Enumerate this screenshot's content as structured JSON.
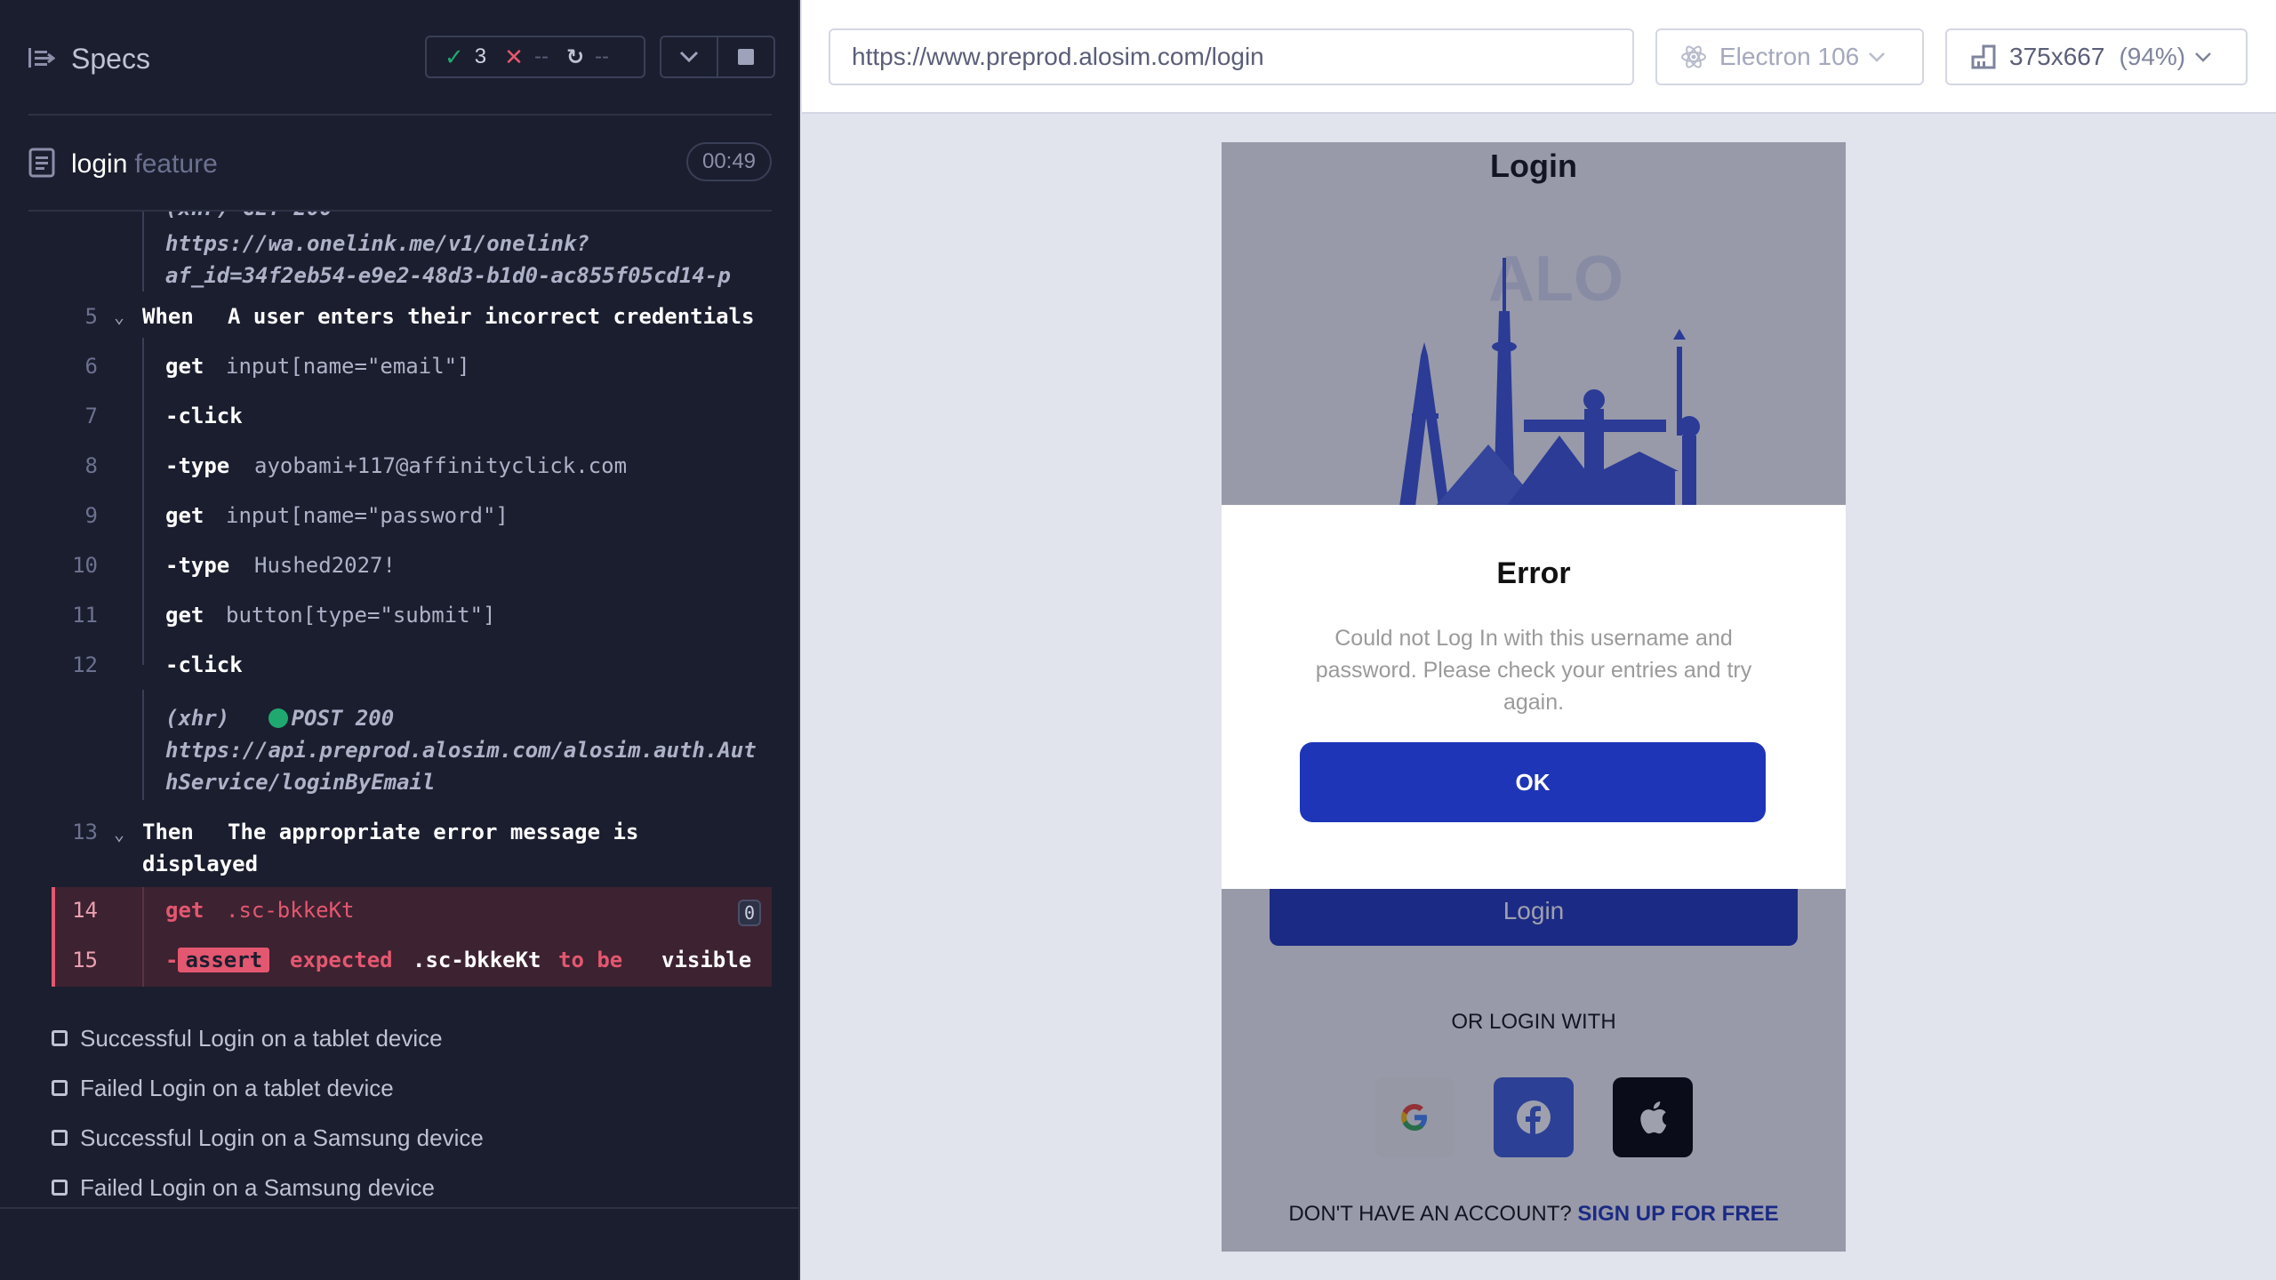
{
  "reporter": {
    "title": "Specs",
    "stats": {
      "passed": "3",
      "failed": "--",
      "pending": "--"
    },
    "feature": {
      "name": "login",
      "kind": "feature",
      "duration": "00:49"
    },
    "commands": {
      "xhr_prev": {
        "partial": "(xhr)   GET 200",
        "url_line1": "https://wa.onelink.me/v1/onelink?",
        "url_line2": "af_id=34f2eb54-e9e2-48d3-b1d0-ac855f05cd14-p"
      },
      "step5": {
        "num": "5",
        "keyword": "When",
        "text": "A user enters their incorrect credentials"
      },
      "c6": {
        "num": "6",
        "cmd": "get",
        "arg": "input[name=\"email\"]"
      },
      "c7": {
        "num": "7",
        "cmd": "-click"
      },
      "c8": {
        "num": "8",
        "cmd": "-type",
        "arg": "ayobami+117@affinityclick.com"
      },
      "c9": {
        "num": "9",
        "cmd": "get",
        "arg": "input[name=\"password\"]"
      },
      "c10": {
        "num": "10",
        "cmd": "-type",
        "arg": "Hushed2027!"
      },
      "c11": {
        "num": "11",
        "cmd": "get",
        "arg": "button[type=\"submit\"]"
      },
      "c12": {
        "num": "12",
        "cmd": "-click"
      },
      "xhr_post": {
        "label": "(xhr)",
        "status": "POST 200",
        "url_line1": "https://api.preprod.alosim.com/alosim.auth.Aut",
        "url_line2": "hService/loginByEmail"
      },
      "step13": {
        "num": "13",
        "keyword": "Then",
        "text_line1": "The appropriate error message is",
        "text_line2": "displayed"
      },
      "c14": {
        "num": "14",
        "cmd": "get",
        "arg": ".sc-bkkeKt",
        "count": "0"
      },
      "c15": {
        "num": "15",
        "prefix": "-",
        "badge": "assert",
        "expected": "expected",
        "selector": ".sc-bkkeKt",
        "tobe": "to be",
        "state": "visible"
      }
    },
    "tests": [
      {
        "label": "Successful Login on a tablet device"
      },
      {
        "label": "Failed Login on a tablet device"
      },
      {
        "label": "Successful Login on a Samsung device"
      },
      {
        "label": "Failed Login on a Samsung device"
      }
    ]
  },
  "preview": {
    "url": "https://www.preprod.alosim.com/login",
    "browser": "Electron 106",
    "viewport": "375x667",
    "zoom": "(94%)"
  },
  "app": {
    "page_title": "Login",
    "login_button": "Login",
    "or_login_with": "OR LOGIN WITH",
    "no_account": "DON'T HAVE AN ACCOUNT?",
    "signup_link": "SIGN UP FOR FREE",
    "modal": {
      "title": "Error",
      "message": "Could not Log In with this username and password. Please check your entries and try again.",
      "ok": "OK"
    }
  },
  "colors": {
    "pass": "#1fa971",
    "fail": "#e45770",
    "app_primary": "#1e35b8",
    "reporter_bg": "#1b1e2e"
  }
}
